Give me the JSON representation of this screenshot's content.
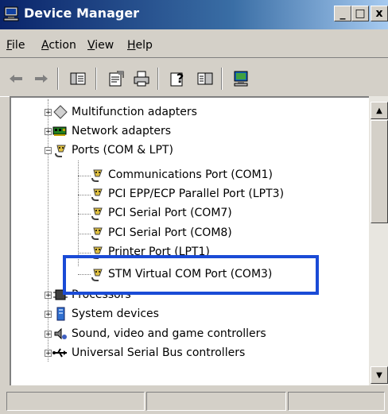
{
  "window": {
    "title": "Device Manager",
    "controls": {
      "minimize": "_",
      "maximize": "□",
      "close": "x"
    }
  },
  "menu": [
    {
      "label": "File",
      "key": "F",
      "rest": "ile"
    },
    {
      "label": "Action",
      "key": "A",
      "rest": "ction"
    },
    {
      "label": "View",
      "key": "V",
      "rest": "iew"
    },
    {
      "label": "Help",
      "key": "H",
      "rest": "elp"
    }
  ],
  "toolbar": {
    "icons": [
      "back-arrow-icon",
      "forward-arrow-icon",
      "show-hide-tree-icon",
      "properties-icon",
      "print-icon",
      "help-icon",
      "view-icon",
      "scan-hardware-icon"
    ]
  },
  "tree": {
    "multifunction": "Multifunction adapters",
    "network": "Network adapters",
    "ports": "Ports (COM & LPT)",
    "com1": "Communications Port (COM1)",
    "lpt3": "PCI EPP/ECP Parallel Port (LPT3)",
    "com7": "PCI Serial Port (COM7)",
    "com8": "PCI Serial Port (COM8)",
    "lpt1": "Printer Port (LPT1)",
    "com3": "STM Virtual COM Port (COM3)",
    "processors": "Processors",
    "system": "System devices",
    "sound": "Sound, video and game controllers",
    "usb": "Universal Serial Bus controllers"
  },
  "colors": {
    "highlight_box": "#1a4bd6",
    "title_bar": "#0a246a",
    "chrome": "#d4d0c8"
  }
}
